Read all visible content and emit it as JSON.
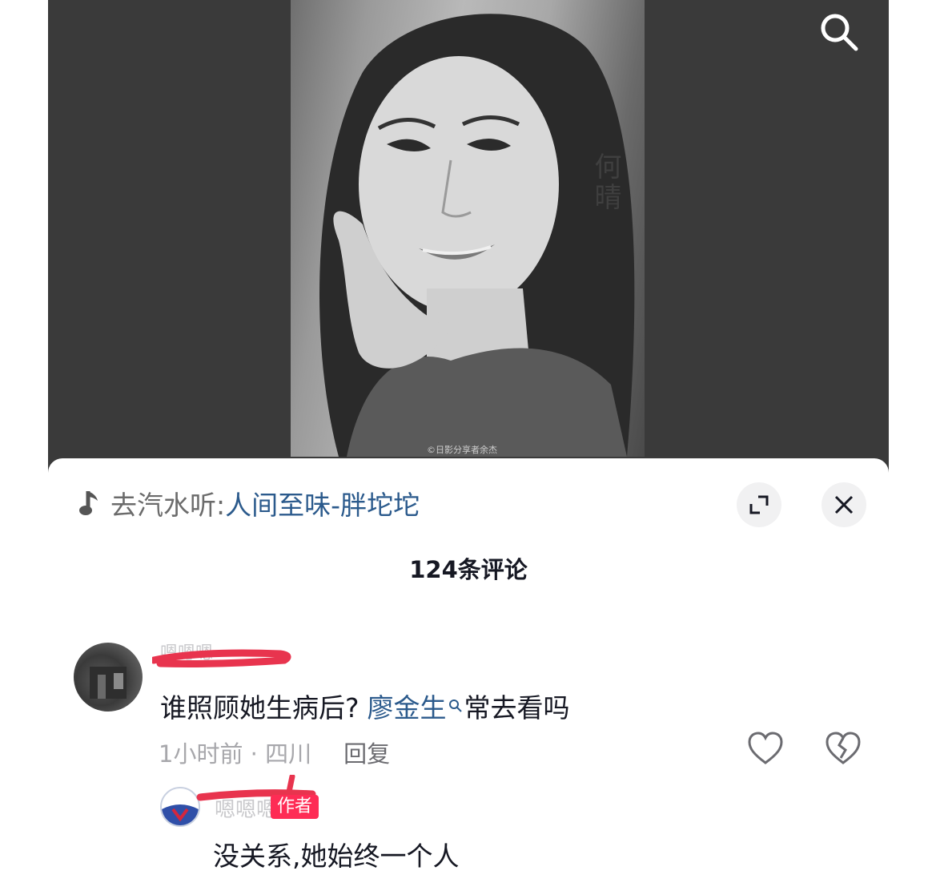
{
  "icons": {
    "search": "search-icon",
    "music": "music-note-icon",
    "expand": "expand-icon",
    "close": "close-icon",
    "like": "heart-icon",
    "dislike": "broken-heart-icon"
  },
  "video": {
    "vertical_name": "何晴",
    "watermark": "©日影分享者余杰"
  },
  "music": {
    "prefix": "去汽水听:",
    "title": "人间至味-胖坨坨"
  },
  "comments_header": {
    "count_label": "124条评论"
  },
  "comment": {
    "username": "嗯嗯嗯",
    "text_before": "谁照顾她生病后?",
    "mention": "廖金生",
    "text_after": "常去看吗",
    "meta": "1小时前 · 四川",
    "reply_label": "回复"
  },
  "reply": {
    "username": "嗯嗯嗯",
    "badge": "作者",
    "text": "没关系,她始终一个人"
  },
  "colors": {
    "accent_red": "#fe2c55",
    "link_blue": "#2b5a8c",
    "redaction": "#e8344e"
  }
}
